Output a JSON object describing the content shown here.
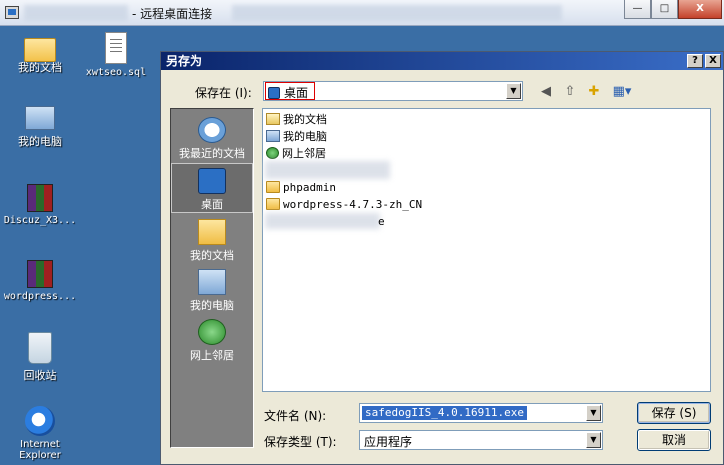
{
  "remote_window": {
    "title": "- 远程桌面连接",
    "buttons": {
      "minimize": "—",
      "restore": "□",
      "close": "X"
    }
  },
  "desktop": {
    "icons": [
      {
        "label": "我的文档",
        "icon": "my-documents-icon"
      },
      {
        "label": "xwtseo.sql",
        "icon": "sql-file-icon"
      },
      {
        "label": "我的电脑",
        "icon": "my-computer-icon"
      },
      {
        "label": "Discuz_X3...",
        "icon": "rar-archive-icon"
      },
      {
        "label": "wordpress...",
        "icon": "rar-archive-icon"
      },
      {
        "label": "回收站",
        "icon": "recycle-bin-icon"
      },
      {
        "label": "Internet Explorer",
        "icon": "internet-explorer-icon"
      }
    ]
  },
  "dialog": {
    "title": "另存为",
    "help_button": "?",
    "close_button": "X",
    "save_in_label": "保存在 (I):",
    "save_in_value": "桌面",
    "places": [
      {
        "label": "我最近的文档",
        "icon": "recent-documents-icon"
      },
      {
        "label": "桌面",
        "icon": "desktop-icon",
        "active": true
      },
      {
        "label": "我的文档",
        "icon": "my-documents-icon"
      },
      {
        "label": "我的电脑",
        "icon": "my-computer-icon"
      },
      {
        "label": "网上邻居",
        "icon": "network-places-icon"
      }
    ],
    "files": [
      {
        "name": "我的文档",
        "icon": "my-documents-icon"
      },
      {
        "name": "我的电脑",
        "icon": "my-computer-icon"
      },
      {
        "name": "网上邻居",
        "icon": "network-places-icon"
      },
      {
        "name": "phpadmin",
        "icon": "folder-icon"
      },
      {
        "name": "wordpress-4.7.3-zh_CN",
        "icon": "folder-icon"
      },
      {
        "name": "e",
        "icon": "file-icon"
      }
    ],
    "filename_label": "文件名 (N):",
    "filename_value": "safedogIIS_4.0.16911.exe",
    "filetype_label": "保存类型 (T):",
    "filetype_value": "应用程序",
    "save_button": "保存 (S)",
    "cancel_button": "取消"
  }
}
